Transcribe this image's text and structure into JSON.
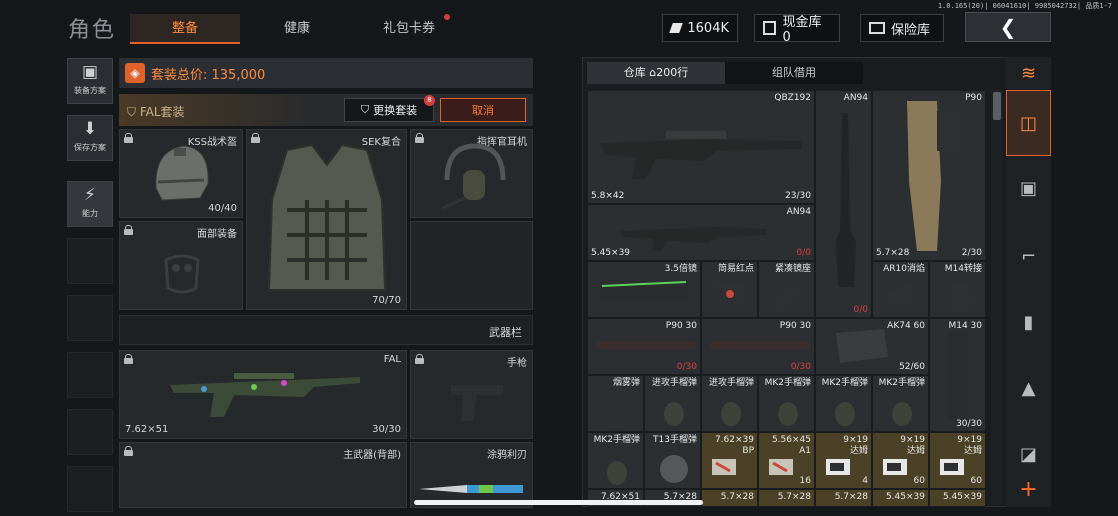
{
  "version": "1.0.165(20)| 06041610| 9985042732| 品质1-7",
  "header": {
    "title": "角色",
    "tabs": [
      {
        "label": "整备"
      },
      {
        "label": "健康"
      },
      {
        "label": "礼包卡券"
      }
    ],
    "currency": "1604K",
    "cash_vault": "现金库 0",
    "safe_box": "保险库"
  },
  "left_menu": {
    "items": [
      {
        "label": "装备方案"
      },
      {
        "label": "保存方案"
      },
      {
        "label": "能力"
      }
    ]
  },
  "loadout": {
    "total_label": "套装总价: 135,000",
    "set_name": "FAL套装",
    "swap_label": "更换套装",
    "swap_badge": "8",
    "cancel_label": "取消",
    "helmet": {
      "name": "KSS战术盔",
      "count": "40/40"
    },
    "armor": {
      "name": "SEK复合",
      "count": "70/70"
    },
    "headset": {
      "name": "指挥官耳机"
    },
    "face": {
      "name": "面部装备"
    },
    "weapon_bar": "武器栏",
    "primary": {
      "name": "FAL",
      "caliber": "7.62×51",
      "count": "30/30"
    },
    "pistol": {
      "name": "手枪"
    },
    "back_weapon": {
      "name": "主武器(背部)"
    },
    "melee": {
      "name": "涂鸦利刃"
    }
  },
  "warehouse": {
    "tabs": [
      {
        "label": "仓库 ⌂200行"
      },
      {
        "label": "组队借用"
      }
    ],
    "cells": [
      {
        "name": "QBZ192",
        "caliber": "5.8×42",
        "count": "23/30"
      },
      {
        "name": "AN94",
        "caliber": "",
        "count": "0/0"
      },
      {
        "name": "P90",
        "caliber": "5.7×28",
        "count": "2/30"
      },
      {
        "name": "AN94",
        "caliber": "5.45×39",
        "count": "0/0"
      },
      {
        "name": "3.5倍镜"
      },
      {
        "name": "简易红点"
      },
      {
        "name": "紧凑镜座"
      },
      {
        "name": "AR10消焰"
      },
      {
        "name": "M14转接"
      },
      {
        "name": "P90 30",
        "count": "0/30"
      },
      {
        "name": "P90 30",
        "count": "0/30"
      },
      {
        "name": "AK74 60",
        "count": "52/60"
      },
      {
        "name": "M14 30",
        "count": "30/30"
      },
      {
        "name": "烟雾弹"
      },
      {
        "name": "进攻手榴弹"
      },
      {
        "name": "进攻手榴弹"
      },
      {
        "name": "MK2手榴弹"
      },
      {
        "name": "MK2手榴弹"
      },
      {
        "name": "MK2手榴弹"
      },
      {
        "name": "MK2手榴弹"
      },
      {
        "name": "T13手榴弹"
      },
      {
        "name": "7.62×39",
        "sub": "BP",
        "count": ""
      },
      {
        "name": "5.56×45",
        "sub": "A1",
        "count": "16"
      },
      {
        "name": "9×19",
        "sub": "达姆",
        "count": "4"
      },
      {
        "name": "9×19",
        "sub": "达姆",
        "count": "60"
      },
      {
        "name": "9×19",
        "sub": "达姆",
        "count": "60"
      },
      {
        "name": "7.62×51"
      },
      {
        "name": "5.7×28"
      },
      {
        "name": "5.7×28"
      },
      {
        "name": "5.7×28"
      },
      {
        "name": "5.7×28"
      },
      {
        "name": "5.45×39"
      },
      {
        "name": "5.45×39"
      }
    ]
  },
  "colors": {
    "accent": "#e0622a",
    "gold_cell": "#4a4126",
    "red_count": "#d94040"
  }
}
